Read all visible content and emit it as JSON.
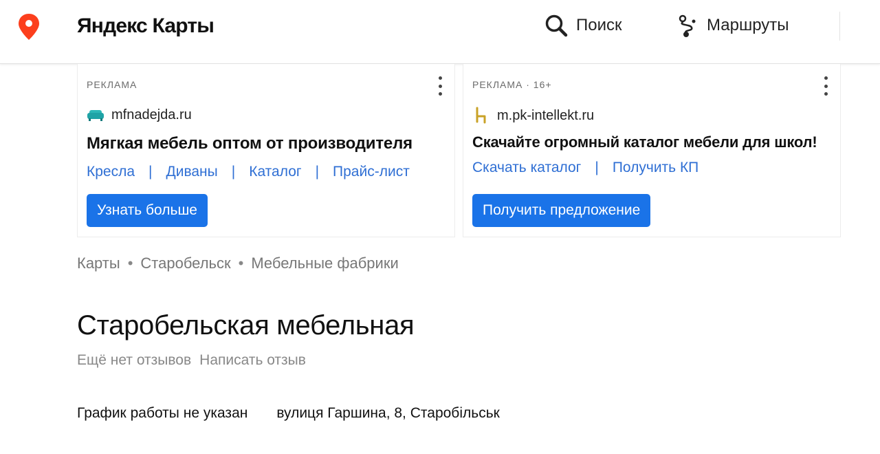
{
  "header": {
    "brand": "Яндекс Карты",
    "search_label": "Поиск",
    "routes_label": "Маршруты",
    "logo_color": "#fc3f1d"
  },
  "ads": [
    {
      "label": "РЕКЛАМА",
      "site": "mfnadejda.ru",
      "site_icon": "sofa-icon",
      "title": "Мягкая мебель оптом от производителя",
      "links": [
        "Кресла",
        "Диваны",
        "Каталог",
        "Прайс-лист"
      ],
      "button": "Узнать больше"
    },
    {
      "label": "РЕКЛАМА · 16+",
      "site": "m.pk-intellekt.ru",
      "site_icon": "chair-icon",
      "title": "Скачайте огромный каталог мебели для школ!",
      "links": [
        "Скачать каталог",
        "Получить КП"
      ],
      "button": "Получить предложение"
    }
  ],
  "breadcrumb": [
    "Карты",
    "Старобельск",
    "Мебельные фабрики"
  ],
  "business": {
    "title": "Старобельская мебельная",
    "no_reviews": "Ещё нет отзывов",
    "write_review": "Написать отзыв",
    "schedule": "График работы не указан",
    "address": "вулиця Гаршина, 8, Старобільськ"
  },
  "colors": {
    "accent": "#1a73e8",
    "link": "#2f6fd4"
  }
}
